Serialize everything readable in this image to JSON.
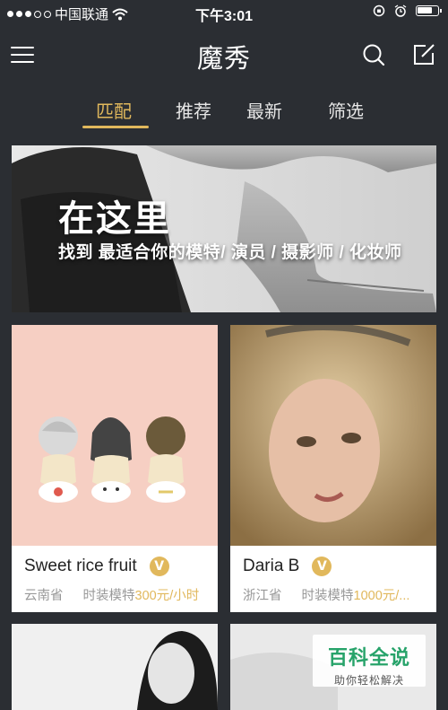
{
  "status_bar": {
    "carrier": "中国联通",
    "time": "下午3:01"
  },
  "header": {
    "title": "魔秀"
  },
  "tabs": [
    {
      "label": "匹配",
      "active": true
    },
    {
      "label": "推荐",
      "active": false
    },
    {
      "label": "最新",
      "active": false
    },
    {
      "label": "筛选",
      "active": false
    }
  ],
  "banner": {
    "title": "在这里",
    "subtitle": "找到 最适合你的模特/ 演员 / 摄影师 / 化妆师"
  },
  "cards": [
    {
      "name": "Sweet rice fruit",
      "badge": "V",
      "location": "云南省",
      "role": "时装模特",
      "price": "300元/小时"
    },
    {
      "name": "Daria B",
      "badge": "V",
      "location": "浙江省",
      "role": "时装模特",
      "price": "1000元/..."
    }
  ],
  "watermark": {
    "title": "百科全说",
    "subtitle": "助你轻松解决"
  },
  "colors": {
    "background": "#2b2e33",
    "accent": "#e1b85c",
    "watermark_green": "#27a36a"
  }
}
